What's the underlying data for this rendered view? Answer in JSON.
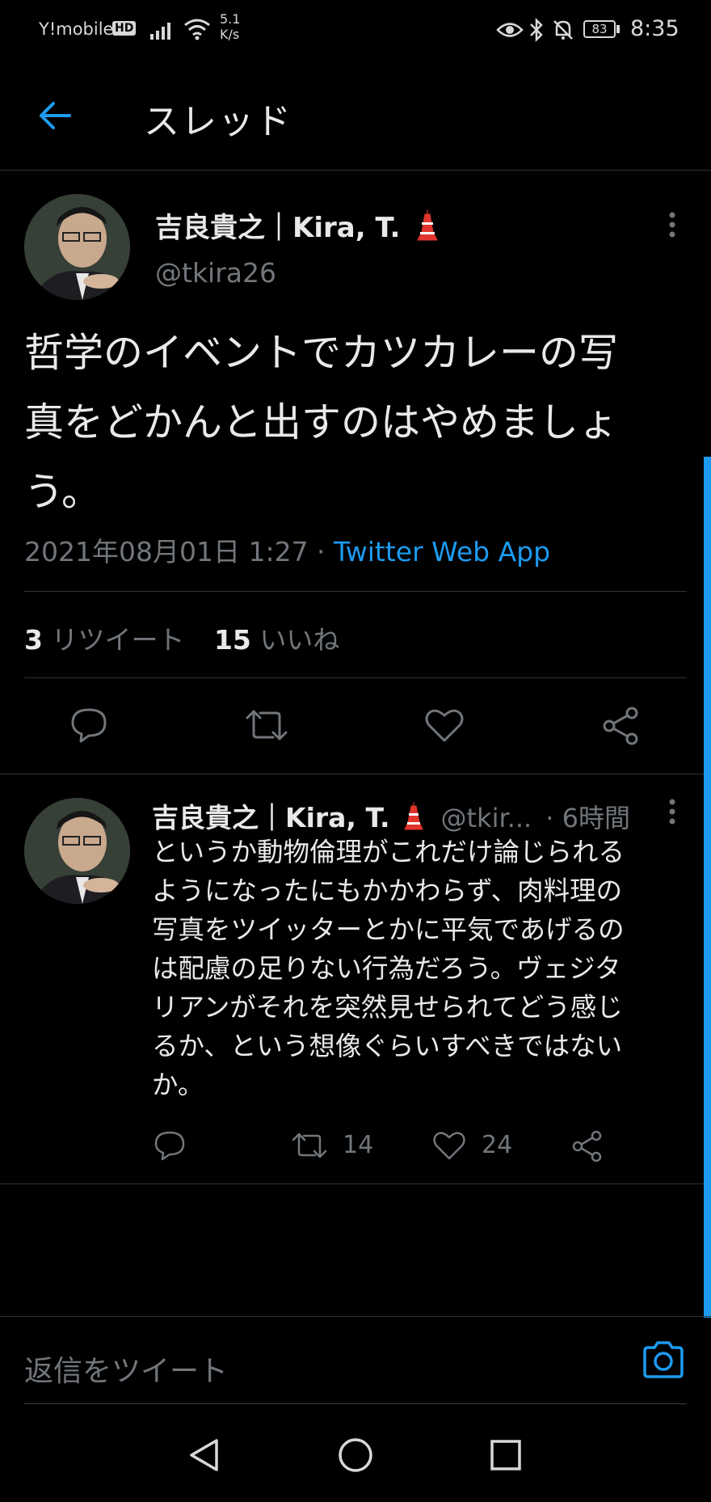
{
  "status_bar": {
    "carrier": "Y!mobile",
    "hd": "HD",
    "net_speed_value": "5.1",
    "net_speed_unit": "K/s",
    "battery": "83",
    "time": "8:35"
  },
  "header": {
    "title": "スレッド"
  },
  "main_tweet": {
    "display_name": "吉良貴之｜Kira, T.",
    "handle": "@tkira26",
    "text_lines": [
      "哲学のイベントでカツカレーの写",
      "真をどかんと出すのはやめましょ",
      "う。"
    ],
    "date": "2021年08月01日 1:27",
    "sep": " · ",
    "source": "Twitter Web App",
    "retweet_count": "3",
    "retweet_label": "リツイート",
    "like_count": "15",
    "like_label": "いいね"
  },
  "reply_tweet": {
    "display_name": "吉良貴之｜Kira, T.",
    "handle": "@tkir...",
    "time": "· 6時間",
    "text_lines": [
      "というか動物倫理がこれだけ論じられる",
      "ようになったにもかかわらず、肉料理の",
      "写真をツイッターとかに平気であげるの",
      "は配慮の足りない行為だろう。ヴェジタ",
      "リアンがそれを突然見せられてどう感じ",
      "るか、という想像ぐらいすべきではない",
      "か。"
    ],
    "retweet_count": "14",
    "like_count": "24"
  },
  "reply_input": {
    "placeholder": "返信をツイート"
  },
  "colors": {
    "accent": "#1d9bf0",
    "background": "#000000",
    "muted": "#71767b"
  },
  "icons": [
    "back-arrow-icon",
    "more-icon",
    "reply-icon",
    "retweet-icon",
    "like-icon",
    "share-icon",
    "camera-icon",
    "nav-back-icon",
    "nav-home-icon",
    "nav-recents-icon"
  ]
}
